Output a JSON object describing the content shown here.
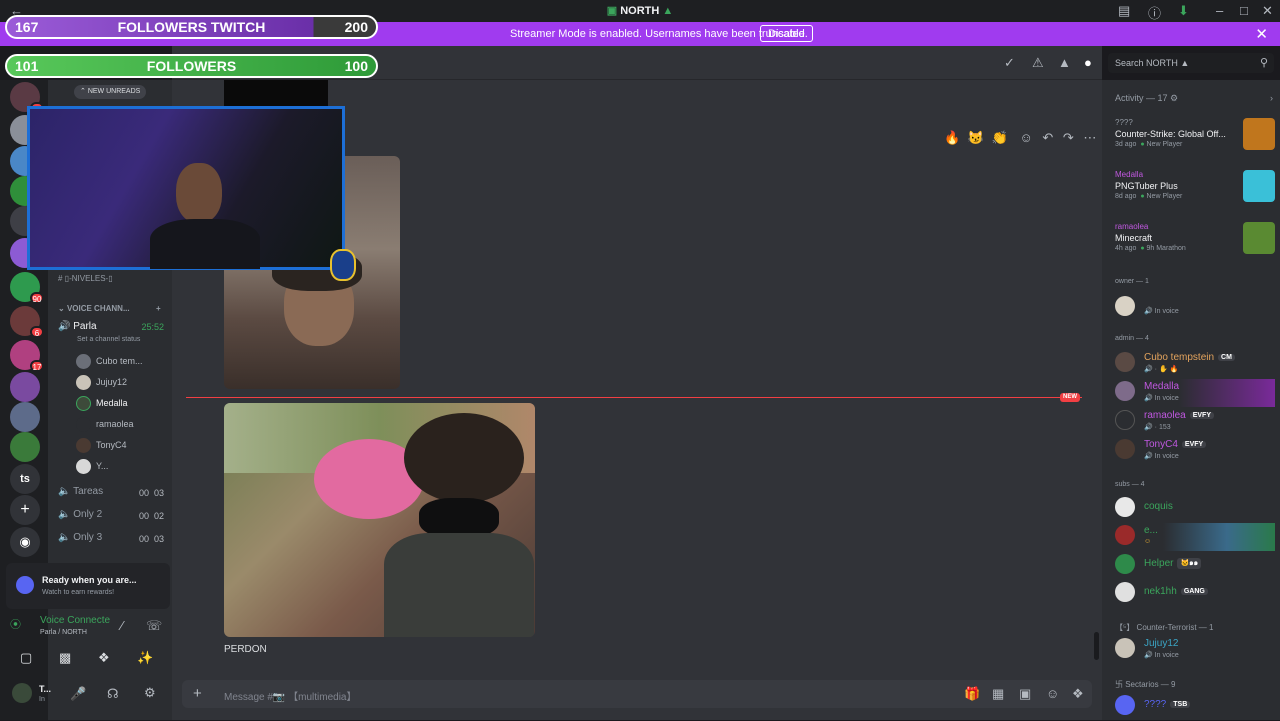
{
  "window": {
    "title": "NORTH"
  },
  "banner": {
    "text": "Streamer Mode is enabled. Usernames have been truncated.",
    "button": "Disable"
  },
  "overlay": {
    "twitch": {
      "left": "167",
      "label": "FOLLOWERS TWITCH",
      "right": "200",
      "progress": 0.83
    },
    "followers": {
      "left": "101",
      "label": "FOLLOWERS",
      "right": "100",
      "progress": 1.0
    }
  },
  "servers": {
    "badges": [
      "24",
      "90",
      "6",
      "17"
    ],
    "ts_label": "ts"
  },
  "channels": {
    "new_unreads": "NEW UNREADS",
    "niveles": "▯-NIVELES-▯",
    "voice_category": "VOICE CHANN...",
    "parla": {
      "name": "Parla",
      "time": "25:52",
      "status": "Set a channel status"
    },
    "voice_users": [
      "Cubo tem...",
      "Jujuy12",
      "Medalla",
      "ramaolea",
      "TonyC4",
      "Y..."
    ],
    "others": [
      {
        "name": "Tareas",
        "a": "00",
        "b": "03"
      },
      {
        "name": "Only 2",
        "a": "00",
        "b": "02"
      },
      {
        "name": "Only 3",
        "a": "00",
        "b": "03"
      }
    ],
    "ready": {
      "title": "Ready when you are...",
      "subtitle": "Watch to earn rewards!"
    },
    "voice": {
      "status": "Voice Connecte",
      "where": "Parla / NORTH"
    },
    "user": {
      "name": "T...",
      "sub": "In"
    }
  },
  "chat": {
    "new_label": "NEW",
    "caption": "PERDON",
    "composer_placeholder": "Message #📷 【multimedia】",
    "reactions": [
      "🔥",
      "😼",
      "👏"
    ]
  },
  "search": {
    "placeholder": "Search NORTH ▲"
  },
  "activity": {
    "header": "Activity — 17",
    "items": [
      {
        "user": "????",
        "game": "Counter-Strike: Global Off...",
        "time": "3d ago",
        "extra": "New Player"
      },
      {
        "user": "Medalla",
        "game": "PNGTuber Plus",
        "time": "8d ago",
        "extra": "New Player"
      },
      {
        "user": "ramaolea",
        "game": "Minecraft",
        "time": "4h ago",
        "extra": "9h Marathon"
      }
    ]
  },
  "members": {
    "owner": {
      "label": "owner — 1",
      "status": "In voice"
    },
    "admin": {
      "label": "admin — 4",
      "list": [
        {
          "name": "Cubo tempstein",
          "tag": "CM",
          "status": "",
          "color": "#e3a35d"
        },
        {
          "name": "Medalla",
          "tag": "",
          "status": "In voice",
          "color": "#c058e0"
        },
        {
          "name": "ramaolea",
          "tag": "EVFY",
          "status": "153",
          "color": "#c058e0"
        },
        {
          "name": "TonyC4",
          "tag": "EVFY",
          "status": "In voice",
          "color": "#c058e0"
        }
      ]
    },
    "subs": {
      "label": "subs — 4",
      "list": [
        {
          "name": "coquis",
          "tag": "",
          "color": "#3ba55c"
        },
        {
          "name": "e...",
          "tag": "",
          "color": "#3ba55c"
        },
        {
          "name": "Helper",
          "tag": "🐱๑๑",
          "color": "#3ba55c"
        },
        {
          "name": "nek1hh",
          "tag": "GANG",
          "color": "#3ba55c"
        }
      ]
    },
    "ct": {
      "label": "【⁵】 Counter-Terrorist — 1",
      "name": "Jujuy12",
      "status": "In voice"
    },
    "sect": {
      "label": "卐 Sectarios — 9",
      "name": "????",
      "tag": "TSB"
    }
  }
}
